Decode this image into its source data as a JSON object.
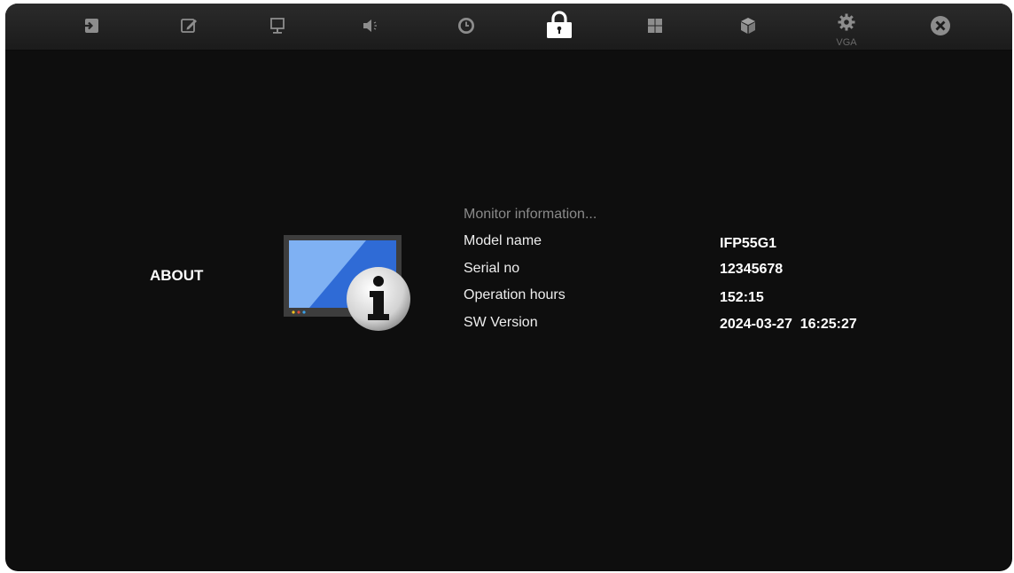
{
  "topbar": {
    "tabs": [
      {
        "icon": "input-source-icon"
      },
      {
        "icon": "edit-icon"
      },
      {
        "icon": "display-icon"
      },
      {
        "icon": "speaker-icon"
      },
      {
        "icon": "clock-icon"
      },
      {
        "icon": "lock-icon",
        "active": true
      },
      {
        "icon": "grid-icon"
      },
      {
        "icon": "cube-icon"
      },
      {
        "icon": "gear-icon",
        "sublabel": "VGA"
      },
      {
        "icon": "close-icon"
      }
    ]
  },
  "section": {
    "title": "ABOUT"
  },
  "info": {
    "heading": "Monitor information...",
    "rows": [
      {
        "label": "Model name",
        "value": "IFP55G1"
      },
      {
        "label": "Serial no",
        "value": "12345678"
      },
      {
        "label": "Operation hours",
        "value": "152:15"
      },
      {
        "label": "SW Version",
        "value": "2024-03-27  16:25:27"
      }
    ]
  },
  "colors": {
    "background": "#0e0e0e",
    "topbar": "#222222",
    "icon_dim": "#8a8a8a",
    "icon_active": "#ffffff",
    "screen_blue": "#2f6bd6"
  }
}
